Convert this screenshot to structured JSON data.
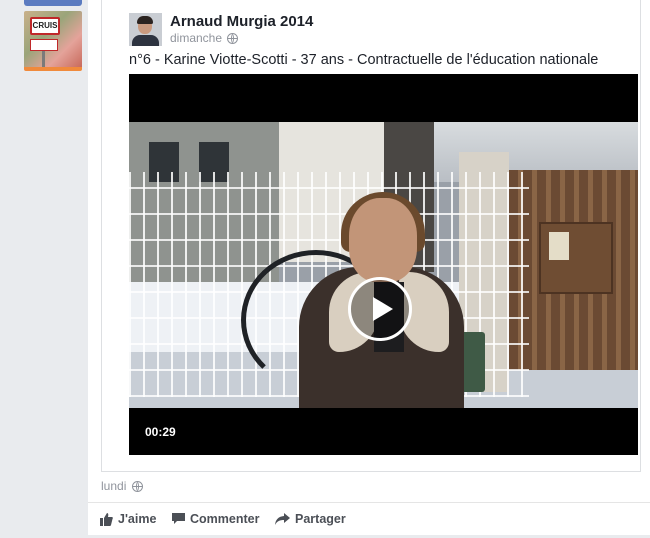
{
  "shared_post": {
    "author": "Arnaud Murgia 2014",
    "timestamp": "dimanche",
    "text": "n°6 - Karine Viotte-Scotti - 37 ans - Contractuelle de l'éducation nationale",
    "video": {
      "duration": "00:29"
    }
  },
  "sidebar": {
    "thumbnail_sign_text": "CRUIS"
  },
  "outer_post": {
    "timestamp": "lundi"
  },
  "actions": {
    "like": "J'aime",
    "comment": "Commenter",
    "share": "Partager"
  },
  "icons": {
    "privacy": "globe-icon",
    "like": "thumbs-up-icon",
    "comment": "speech-bubble-icon",
    "share": "share-arrow-icon",
    "play": "play-icon"
  },
  "colors": {
    "link_text": "#4b4f56",
    "meta_text": "#90949c",
    "author_text": "#1d2129"
  }
}
